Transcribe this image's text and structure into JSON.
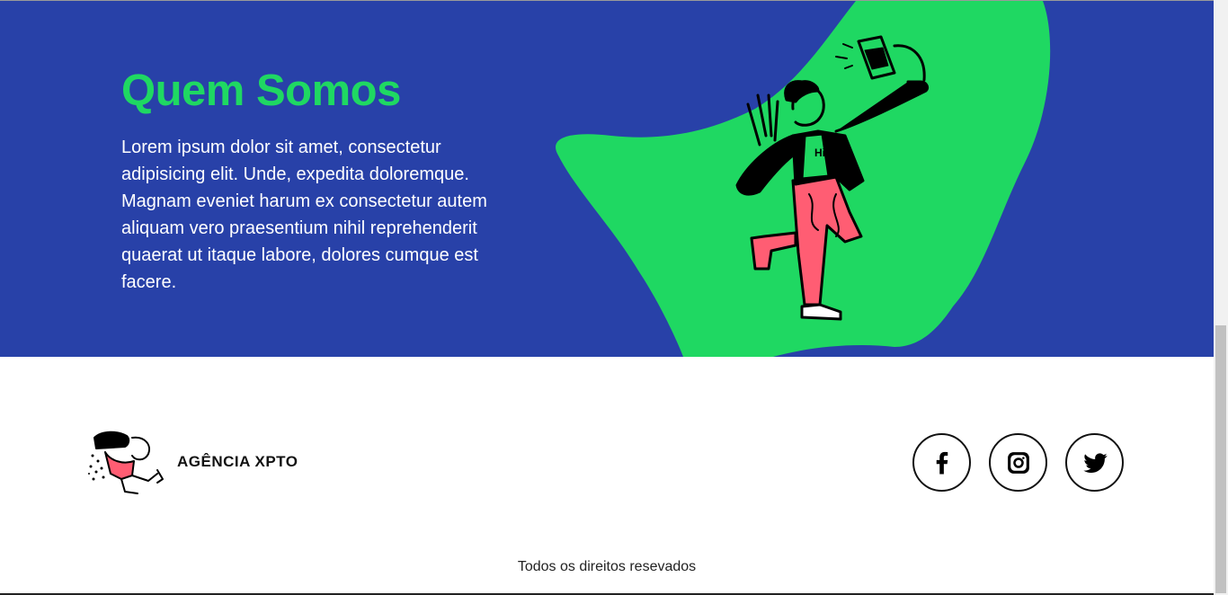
{
  "about": {
    "title": "Quem Somos",
    "text": "Lorem ipsum dolor sit amet, consectetur adipisicing elit. Unde, expedita doloremque. Magnam eveniet harum ex consectetur autem aliquam vero praesentium nihil reprehenderit quaerat ut itaque labore, dolores cumque est facere.",
    "illustration_shirt_text": "Hi"
  },
  "colors": {
    "section_bg": "#2841a8",
    "accent_green": "#1fd862",
    "pants_pink": "#ff5d73"
  },
  "footer": {
    "brand_name": "AGÊNCIA XPTO",
    "social": [
      {
        "name": "facebook",
        "icon": "facebook-icon"
      },
      {
        "name": "instagram",
        "icon": "instagram-icon"
      },
      {
        "name": "twitter",
        "icon": "twitter-icon"
      }
    ],
    "copyright": "Todos os direitos resevados"
  }
}
